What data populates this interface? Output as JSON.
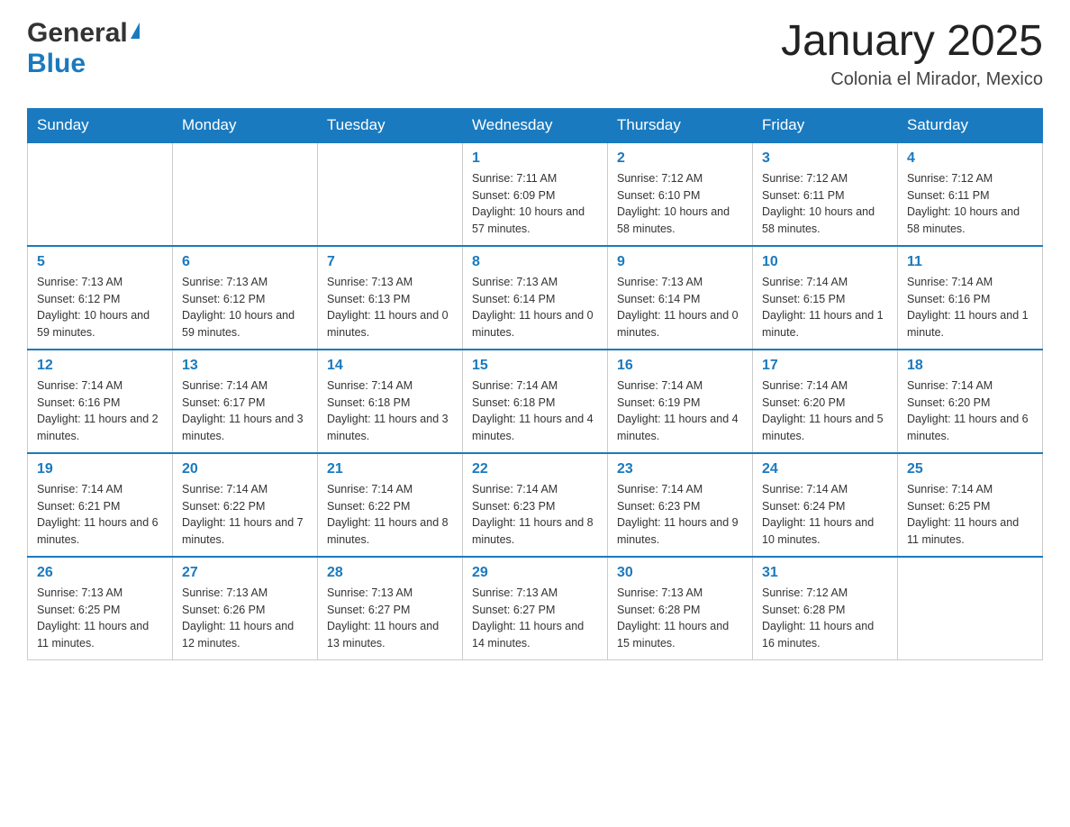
{
  "header": {
    "logo_general": "General",
    "logo_blue": "Blue",
    "month_title": "January 2025",
    "location": "Colonia el Mirador, Mexico"
  },
  "days_of_week": [
    "Sunday",
    "Monday",
    "Tuesday",
    "Wednesday",
    "Thursday",
    "Friday",
    "Saturday"
  ],
  "weeks": [
    {
      "days": [
        {
          "num": "",
          "info": ""
        },
        {
          "num": "",
          "info": ""
        },
        {
          "num": "",
          "info": ""
        },
        {
          "num": "1",
          "info": "Sunrise: 7:11 AM\nSunset: 6:09 PM\nDaylight: 10 hours and 57 minutes."
        },
        {
          "num": "2",
          "info": "Sunrise: 7:12 AM\nSunset: 6:10 PM\nDaylight: 10 hours and 58 minutes."
        },
        {
          "num": "3",
          "info": "Sunrise: 7:12 AM\nSunset: 6:11 PM\nDaylight: 10 hours and 58 minutes."
        },
        {
          "num": "4",
          "info": "Sunrise: 7:12 AM\nSunset: 6:11 PM\nDaylight: 10 hours and 58 minutes."
        }
      ]
    },
    {
      "days": [
        {
          "num": "5",
          "info": "Sunrise: 7:13 AM\nSunset: 6:12 PM\nDaylight: 10 hours and 59 minutes."
        },
        {
          "num": "6",
          "info": "Sunrise: 7:13 AM\nSunset: 6:12 PM\nDaylight: 10 hours and 59 minutes."
        },
        {
          "num": "7",
          "info": "Sunrise: 7:13 AM\nSunset: 6:13 PM\nDaylight: 11 hours and 0 minutes."
        },
        {
          "num": "8",
          "info": "Sunrise: 7:13 AM\nSunset: 6:14 PM\nDaylight: 11 hours and 0 minutes."
        },
        {
          "num": "9",
          "info": "Sunrise: 7:13 AM\nSunset: 6:14 PM\nDaylight: 11 hours and 0 minutes."
        },
        {
          "num": "10",
          "info": "Sunrise: 7:14 AM\nSunset: 6:15 PM\nDaylight: 11 hours and 1 minute."
        },
        {
          "num": "11",
          "info": "Sunrise: 7:14 AM\nSunset: 6:16 PM\nDaylight: 11 hours and 1 minute."
        }
      ]
    },
    {
      "days": [
        {
          "num": "12",
          "info": "Sunrise: 7:14 AM\nSunset: 6:16 PM\nDaylight: 11 hours and 2 minutes."
        },
        {
          "num": "13",
          "info": "Sunrise: 7:14 AM\nSunset: 6:17 PM\nDaylight: 11 hours and 3 minutes."
        },
        {
          "num": "14",
          "info": "Sunrise: 7:14 AM\nSunset: 6:18 PM\nDaylight: 11 hours and 3 minutes."
        },
        {
          "num": "15",
          "info": "Sunrise: 7:14 AM\nSunset: 6:18 PM\nDaylight: 11 hours and 4 minutes."
        },
        {
          "num": "16",
          "info": "Sunrise: 7:14 AM\nSunset: 6:19 PM\nDaylight: 11 hours and 4 minutes."
        },
        {
          "num": "17",
          "info": "Sunrise: 7:14 AM\nSunset: 6:20 PM\nDaylight: 11 hours and 5 minutes."
        },
        {
          "num": "18",
          "info": "Sunrise: 7:14 AM\nSunset: 6:20 PM\nDaylight: 11 hours and 6 minutes."
        }
      ]
    },
    {
      "days": [
        {
          "num": "19",
          "info": "Sunrise: 7:14 AM\nSunset: 6:21 PM\nDaylight: 11 hours and 6 minutes."
        },
        {
          "num": "20",
          "info": "Sunrise: 7:14 AM\nSunset: 6:22 PM\nDaylight: 11 hours and 7 minutes."
        },
        {
          "num": "21",
          "info": "Sunrise: 7:14 AM\nSunset: 6:22 PM\nDaylight: 11 hours and 8 minutes."
        },
        {
          "num": "22",
          "info": "Sunrise: 7:14 AM\nSunset: 6:23 PM\nDaylight: 11 hours and 8 minutes."
        },
        {
          "num": "23",
          "info": "Sunrise: 7:14 AM\nSunset: 6:23 PM\nDaylight: 11 hours and 9 minutes."
        },
        {
          "num": "24",
          "info": "Sunrise: 7:14 AM\nSunset: 6:24 PM\nDaylight: 11 hours and 10 minutes."
        },
        {
          "num": "25",
          "info": "Sunrise: 7:14 AM\nSunset: 6:25 PM\nDaylight: 11 hours and 11 minutes."
        }
      ]
    },
    {
      "days": [
        {
          "num": "26",
          "info": "Sunrise: 7:13 AM\nSunset: 6:25 PM\nDaylight: 11 hours and 11 minutes."
        },
        {
          "num": "27",
          "info": "Sunrise: 7:13 AM\nSunset: 6:26 PM\nDaylight: 11 hours and 12 minutes."
        },
        {
          "num": "28",
          "info": "Sunrise: 7:13 AM\nSunset: 6:27 PM\nDaylight: 11 hours and 13 minutes."
        },
        {
          "num": "29",
          "info": "Sunrise: 7:13 AM\nSunset: 6:27 PM\nDaylight: 11 hours and 14 minutes."
        },
        {
          "num": "30",
          "info": "Sunrise: 7:13 AM\nSunset: 6:28 PM\nDaylight: 11 hours and 15 minutes."
        },
        {
          "num": "31",
          "info": "Sunrise: 7:12 AM\nSunset: 6:28 PM\nDaylight: 11 hours and 16 minutes."
        },
        {
          "num": "",
          "info": ""
        }
      ]
    }
  ]
}
